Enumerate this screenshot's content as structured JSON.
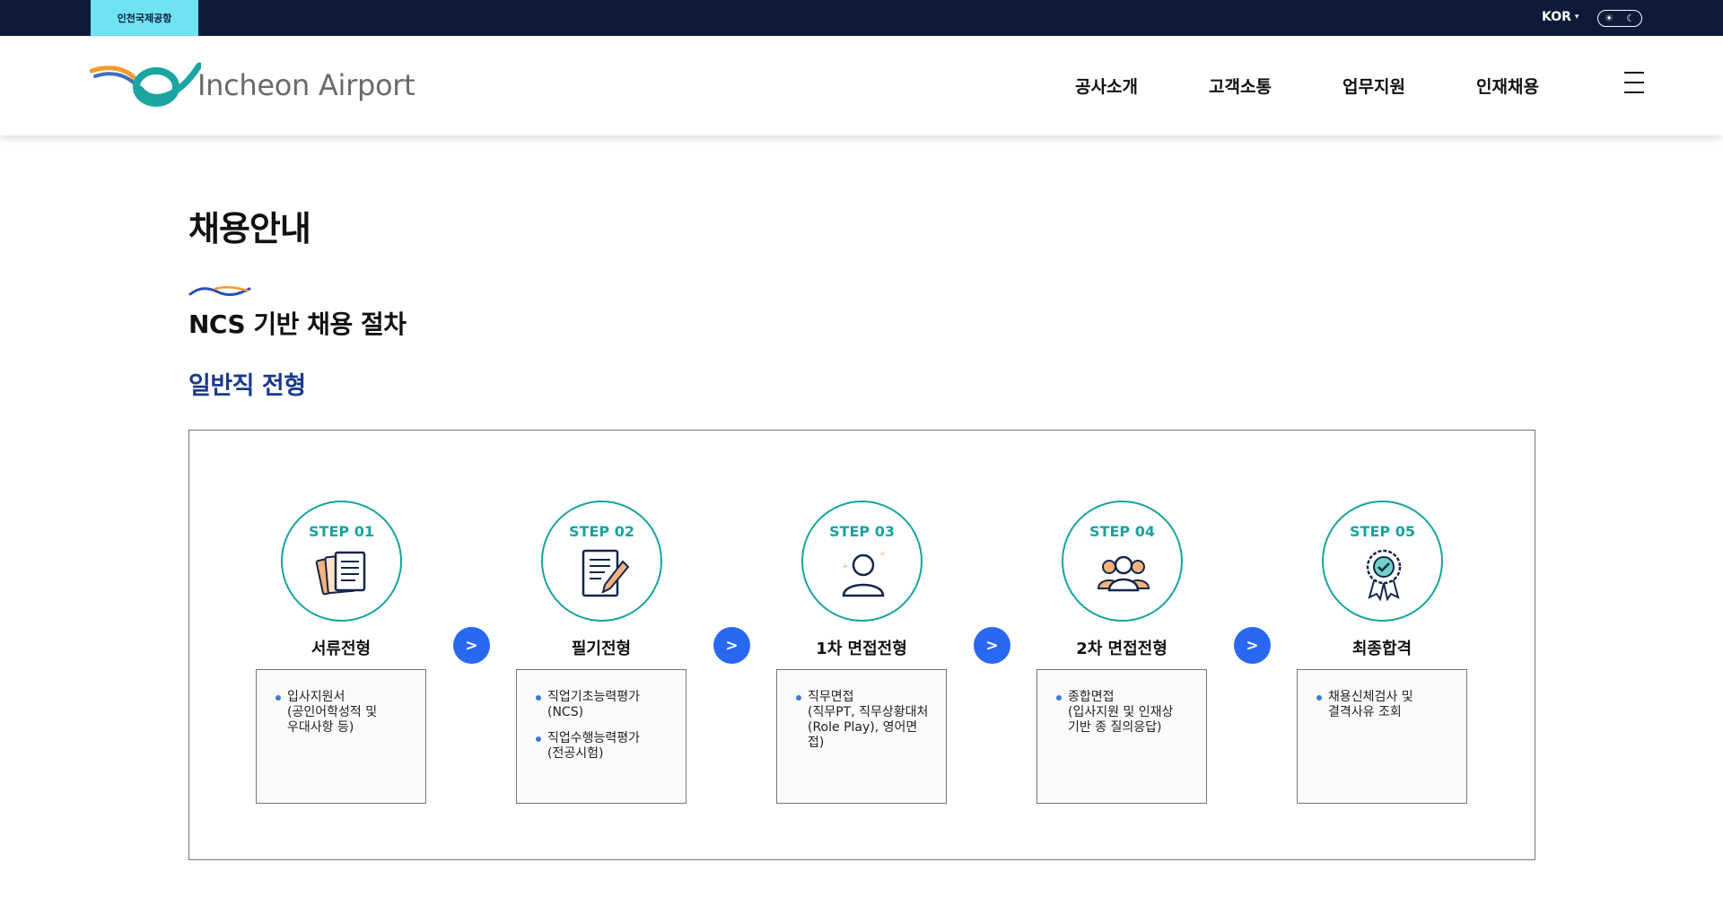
{
  "topbar": {
    "tab_label": "인천국제공항",
    "lang_label": "KOR",
    "sun_icon": "sun-icon",
    "moon_icon": "moon-icon"
  },
  "header": {
    "logo_text": "Incheon Airport",
    "nav": [
      "공사소개",
      "고객소통",
      "업무지원",
      "인재채용"
    ],
    "menu_icon": "hamburger-icon"
  },
  "colors": {
    "topbar": "#0d1a3a",
    "top_tab": "#6fe3f2",
    "teal": "#17a3a0",
    "arrow_blue": "#2968f0",
    "sub_title": "#1a3a8a"
  },
  "content": {
    "page_title": "채용안내",
    "section_title": "NCS 기반 채용 절차",
    "sub_title": "일반직 전형"
  },
  "steps": [
    {
      "step": "STEP 01",
      "name": "서류전형",
      "icon": "documents-icon",
      "items": [
        "입사지원서\n(공인어학성적 및\n우대사항 등)"
      ]
    },
    {
      "step": "STEP 02",
      "name": "필기전형",
      "icon": "written-test-icon",
      "items": [
        "직업기초능력평가\n(NCS)",
        "직업수행능력평가\n(전공시험)"
      ]
    },
    {
      "step": "STEP 03",
      "name": "1차 면접전형",
      "icon": "person-icon",
      "items": [
        "직무면접\n(직무PT, 직무상황대처\n(Role Play), 영어면접)"
      ]
    },
    {
      "step": "STEP 04",
      "name": "2차 면접전형",
      "icon": "group-icon",
      "items": [
        "종합면접\n(입사지원 및 인재상\n기반 종 질의응답)"
      ]
    },
    {
      "step": "STEP 05",
      "name": "최종합격",
      "icon": "badge-icon",
      "items": [
        "채용신체검사 및\n결격사유 조회"
      ]
    }
  ],
  "arrow_label": ">"
}
